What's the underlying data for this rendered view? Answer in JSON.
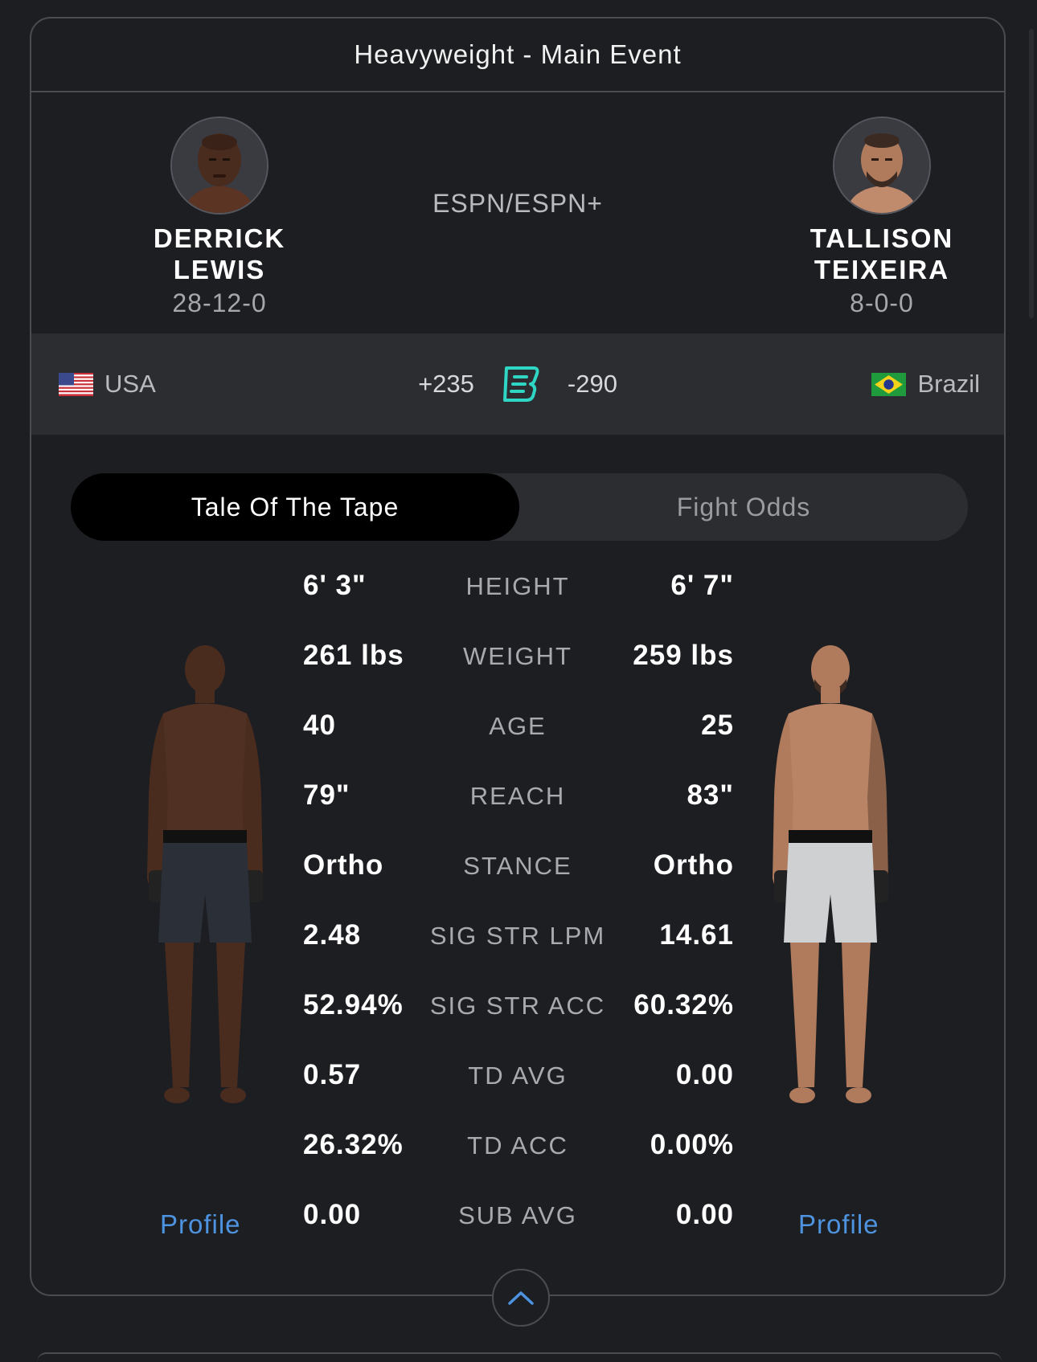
{
  "card": {
    "title": "Heavyweight - Main Event",
    "broadcast": "ESPN/ESPN+"
  },
  "fighters": {
    "left": {
      "first": "DERRICK",
      "last": "LEWIS",
      "record": "28-12-0",
      "country": "USA",
      "odds": "+235",
      "profile_label": "Profile"
    },
    "right": {
      "first": "TALLISON",
      "last": "TEIXEIRA",
      "record": "8-0-0",
      "country": "Brazil",
      "odds": "-290",
      "profile_label": "Profile"
    }
  },
  "sportsbook_icon": "betting-book-icon",
  "tabs": [
    {
      "label": "Tale Of The Tape",
      "active": true
    },
    {
      "label": "Fight Odds",
      "active": false
    }
  ],
  "stats": [
    {
      "label": "HEIGHT",
      "left": "6' 3\"",
      "right": "6' 7\""
    },
    {
      "label": "WEIGHT",
      "left": "261 lbs",
      "right": "259 lbs"
    },
    {
      "label": "AGE",
      "left": "40",
      "right": "25"
    },
    {
      "label": "REACH",
      "left": "79\"",
      "right": "83\""
    },
    {
      "label": "STANCE",
      "left": "Ortho",
      "right": "Ortho"
    },
    {
      "label": "SIG STR LPM",
      "left": "2.48",
      "right": "14.61"
    },
    {
      "label": "SIG STR ACC",
      "left": "52.94%",
      "right": "60.32%"
    },
    {
      "label": "TD AVG",
      "left": "0.57",
      "right": "0.00"
    },
    {
      "label": "TD ACC",
      "left": "26.32%",
      "right": "0.00%"
    },
    {
      "label": "SUB AVG",
      "left": "0.00",
      "right": "0.00"
    }
  ],
  "colors": {
    "background": "#1d1e22",
    "panel": "#2c2d31",
    "link": "#4d93e0",
    "accent_teal": "#2fd6c4"
  }
}
